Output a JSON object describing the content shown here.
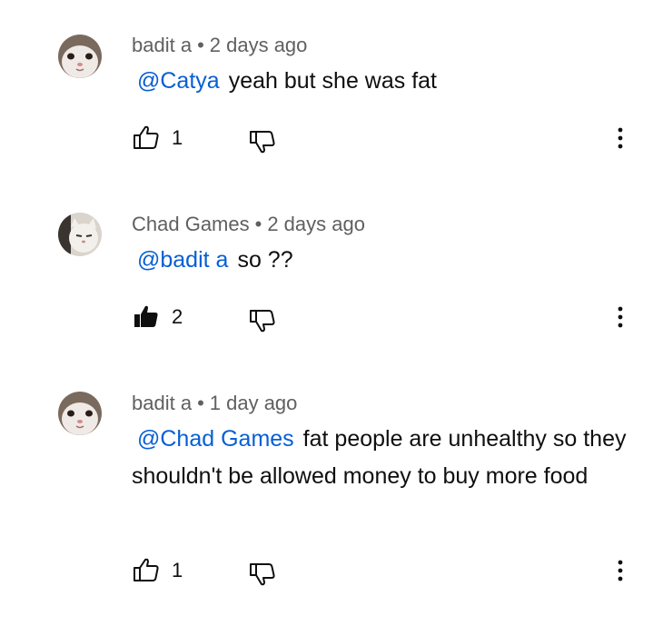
{
  "comments": [
    {
      "author": "badit a",
      "separator": "•",
      "time": "2 days ago",
      "mention": "@Catya",
      "text": "yeah but she was fat",
      "likes": "1",
      "liked": false,
      "like_icon": "thumbs-up-outline-icon",
      "dislike_icon": "thumbs-down-outline-icon",
      "more_icon": "more-vertical-icon"
    },
    {
      "author": "Chad Games",
      "separator": "•",
      "time": "2 days ago",
      "mention": "@badit a",
      "text": "so ??",
      "likes": "2",
      "liked": true,
      "like_icon": "thumbs-up-filled-icon",
      "dislike_icon": "thumbs-down-outline-icon",
      "more_icon": "more-vertical-icon"
    },
    {
      "author": "badit a",
      "separator": "•",
      "time": "1 day ago",
      "mention": "@Chad Games",
      "text": "fat people are unhealthy so they shouldn't be allowed money to buy more food",
      "likes": "1",
      "liked": false,
      "like_icon": "thumbs-up-outline-icon",
      "dislike_icon": "thumbs-down-outline-icon",
      "more_icon": "more-vertical-icon"
    }
  ],
  "colors": {
    "mention": "#065fd4",
    "meta": "#606060",
    "text": "#0f0f0f"
  }
}
